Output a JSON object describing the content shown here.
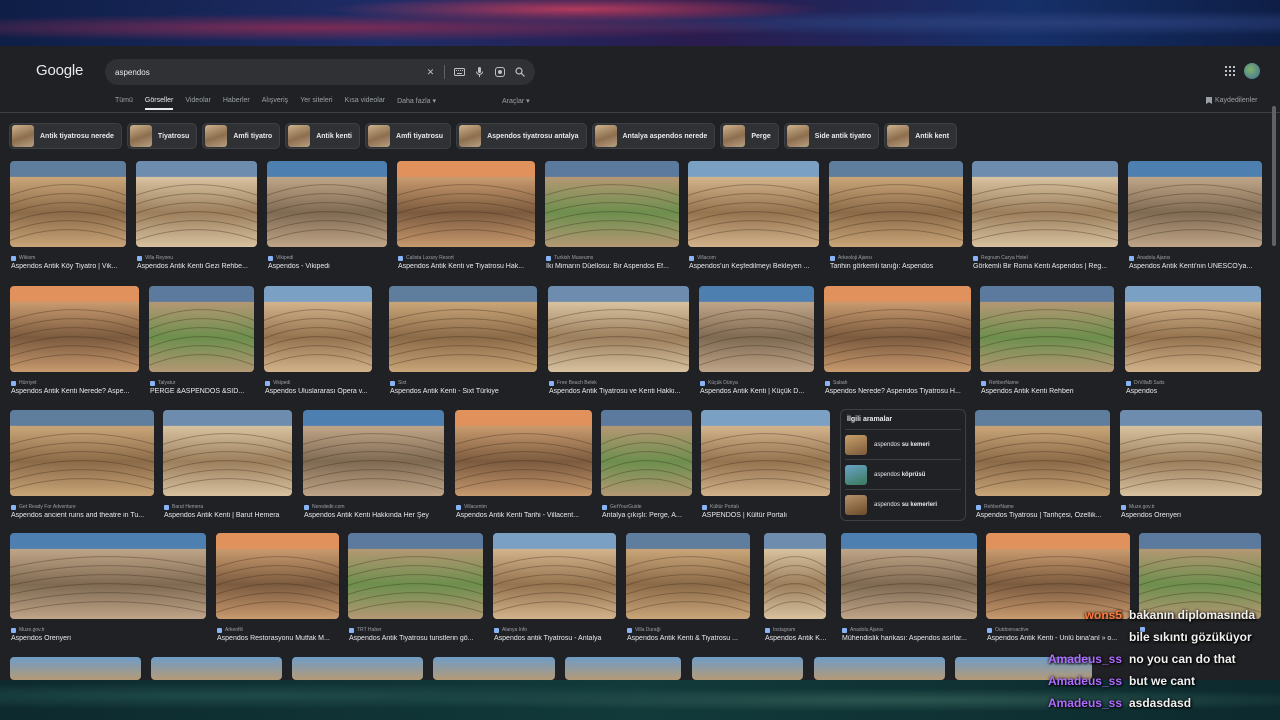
{
  "search": {
    "logo": "Google",
    "query": "aspendos"
  },
  "tabs": [
    "Tümü",
    "Görseller",
    "Videolar",
    "Haberler",
    "Alışveriş",
    "Yer siteleri",
    "Kısa videolar",
    "Daha fazla ▾"
  ],
  "active_tab": "Görseller",
  "tools_label": "Araçlar ▾",
  "saved_label": "Kaydedilenler",
  "chips": [
    "Antik tiyatrosu nerede",
    "Tiyatrosu",
    "Amfi tiyatro",
    "Antik kenti",
    "Amfi tiyatrosu",
    "Aspendos tiyatrosu antalya",
    "Antalya aspendos nerede",
    "Perge",
    "Side antik tiyatro",
    "Antik kent"
  ],
  "results": [
    {
      "source": "Wikiom",
      "title": "Aspendos Antik Köy Tiyatro | Vik..."
    },
    {
      "source": "Villa Reyonu",
      "title": "Aspendos Antik Kenti Gezi Rehbe..."
    },
    {
      "source": "Vikipedi",
      "title": "Aspendos - Vikipedi"
    },
    {
      "source": "Calista Luxury Resort",
      "title": "Aspendos Antik Kenti ve Tiyatrosu Hak..."
    },
    {
      "source": "Turkish Museums",
      "title": "İki Mimarın Düellosu: Bir Aspendos Ef..."
    },
    {
      "source": "Villacom",
      "title": "Aspendos'un Keşfedilmeyi Bekleyen ..."
    },
    {
      "source": "Arkeoloji Ajansı",
      "title": "Tarihin görkemli tanığı: Aspendos"
    },
    {
      "source": "Regnum Carya Hotel",
      "title": "Görkemli Bir Roma Kenti Aspendos | Reg..."
    },
    {
      "source": "Anadolu Ajansı",
      "title": "Aspendos Antik Kenti'nin UNESCO'ya..."
    },
    {
      "source": "Hürriyet",
      "title": "Aspendos Antik Kenti Nerede? Aspe..."
    },
    {
      "source": "Talyatur",
      "title": "PERGE &ASPENDOS &SID..."
    },
    {
      "source": "Vikipedi",
      "title": "Aspendos Uluslararası Opera v..."
    },
    {
      "source": "Sixt",
      "title": "Aspendos Antik Kenti - Sixt Türkiye"
    },
    {
      "source": "Free Beach Belek",
      "title": "Aspendos Antik Tiyatrosu ve Kenti Hakkı..."
    },
    {
      "source": "Küçük Dünya",
      "title": "Aspendos Antik Kenti | Küçük D..."
    },
    {
      "source": "Sabah",
      "title": "Aspendos Nerede? Aspendos Tiyatrosu H..."
    },
    {
      "source": "RehberName",
      "title": "Aspendos Antik Kenti Rehberi"
    },
    {
      "source": "DrVillaB Suits",
      "title": "Aspendos"
    },
    {
      "source": "Get Ready For Adventure",
      "title": "Aspendos ancient ruins and theatre in Tu..."
    },
    {
      "source": "Barut Hemera",
      "title": "Aspendos Antik Kenti | Barut Hemera"
    },
    {
      "source": "Nerededir.com",
      "title": "Aspendos Antik Kenti Hakkında Her Şey"
    },
    {
      "source": "Villacentm",
      "title": "Aspendos Antik Kenti Tarihi - Villacent..."
    },
    {
      "source": "GetYourGuide",
      "title": "Antalya çıkışlı: Perge, A..."
    },
    {
      "source": "Kültür Portalı",
      "title": "ASPENDOS | Kültür Portalı"
    },
    {
      "source": "RehberName",
      "title": "Aspendos Tiyatrosu | Tarihçesi, Özellik..."
    },
    {
      "source": "Muze.gov.tr",
      "title": "Aspendos Örenyeri"
    },
    {
      "source": "Muze.gov.tr",
      "title": "Aspendos Örenyeri"
    },
    {
      "source": "Arkeofili",
      "title": "Aspendos Restorasyonu Mutfak M..."
    },
    {
      "source": "TRT Haber",
      "title": "Aspendos Antik Tiyatrosu turistlerin gö..."
    },
    {
      "source": "Alanya Info",
      "title": "Aspendos antik Tiyatrosu - Antalya"
    },
    {
      "source": "Villa Duraği",
      "title": "Aspendos Antik Kenti & Tiyatrosu ..."
    },
    {
      "source": "Instagram",
      "title": "Aspendos Antik Ke..."
    },
    {
      "source": "Anadolu Ajansı",
      "title": "Mühendislik harikası: Aspendos asırlar..."
    },
    {
      "source": "Outdoorsactive",
      "title": "Aspendos Antik Kenti - Ünlü bina'anl » o..."
    }
  ],
  "related": {
    "heading": "İlgili aramalar",
    "items": [
      {
        "prefix": "aspendos ",
        "bold": "su kemeri"
      },
      {
        "prefix": "aspendos ",
        "bold": "köprüsü"
      },
      {
        "prefix": "aspendos ",
        "bold": "su kemerleri"
      }
    ]
  },
  "chat": [
    {
      "user": "wons5",
      "color": "#ff7a3c",
      "text": "bakanın diplomasında"
    },
    {
      "user": "",
      "color": "#ff7a3c",
      "text": "bile sıkıntı gözüküyor"
    },
    {
      "user": "Amadeus_ss",
      "color": "#b06bff",
      "text": "no you can do that"
    },
    {
      "user": "Amadeus_ss",
      "color": "#b06bff",
      "text": "but we cant"
    },
    {
      "user": "Amadeus_ss",
      "color": "#b06bff",
      "text": "asdasdasd"
    }
  ],
  "colors": {
    "page_bg": "#202124",
    "search_bg": "#303134",
    "text": "#e8eaed",
    "muted": "#9aa0a6"
  }
}
